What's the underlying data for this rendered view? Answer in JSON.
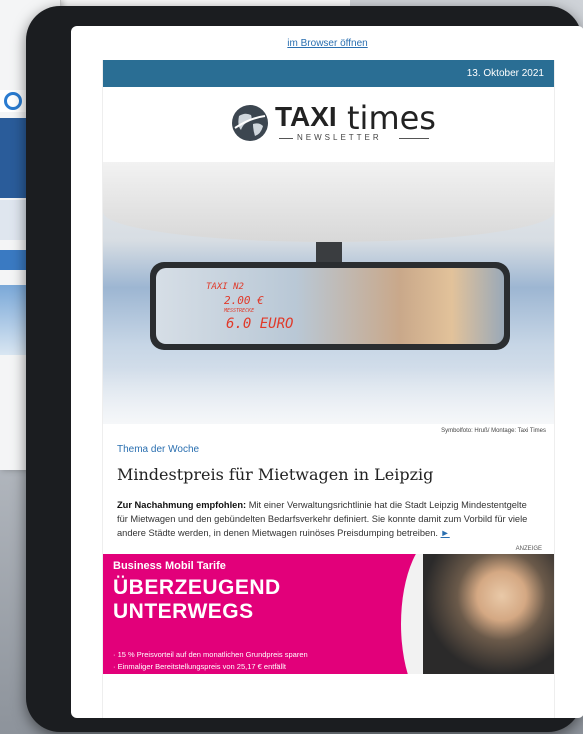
{
  "newsletter": {
    "browser_link": "im Browser öffnen",
    "date": "13. Oktober 2021",
    "logo_taxi": "TAXI",
    "logo_times": "times",
    "logo_sub": "NEWSLETTER",
    "image_caption": "Symbolfoto: Hruß/ Montage: Taxi Times",
    "kicker": "Thema der Woche",
    "headline": "Mindestpreis für Mietwagen in Leipzig",
    "lead_bold": "Zur Nachahmung empfohlen:",
    "lead_text": " Mit einer Verwaltungsrichtlinie hat die Stadt Leipzig Mindestentgelte für Mietwagen und den gebündelten Bedarfsverkehr definiert. Sie konnte damit zum Vorbild für viele andere Städte werden, in denen Mietwagen ruinöses Preisdumping betreiben.",
    "more_arrow": "►"
  },
  "mirror_display": {
    "line1": "TAXI  N2",
    "line2": "2.00 €",
    "line3": "MESSTRECKE",
    "line4": "6.0 EURO"
  },
  "ad": {
    "label": "ANZEIGE",
    "small": "Business Mobil Tarife",
    "big1": "ÜBERZEUGEND",
    "big2": "UNTERWEGS",
    "bullet1": "· 15 % Preisvorteil auf den monatlichen Grundpreis sparen",
    "bullet2": "· Einmaliger Bereitstellungspreis von 25,17 € entfällt",
    "color": "#e2007a"
  },
  "colors": {
    "date_bar": "#2a6e94",
    "link": "#2a6fb0"
  }
}
